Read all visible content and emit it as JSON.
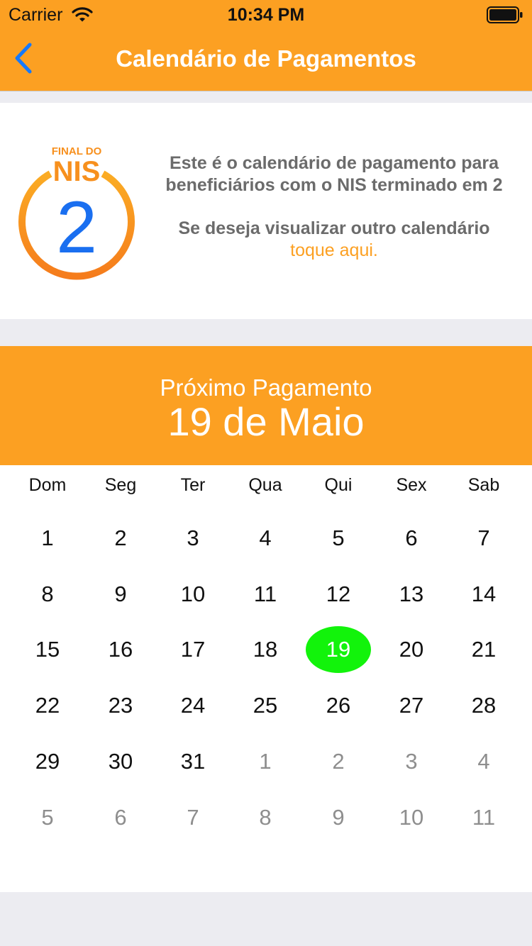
{
  "status_bar": {
    "carrier": "Carrier",
    "time": "10:34 PM"
  },
  "nav": {
    "title": "Calendário de Pagamentos",
    "back_icon": "chevron-left-icon"
  },
  "badge": {
    "top_text": "FINAL DO",
    "middle_text": "NIS",
    "digit": "2"
  },
  "info": {
    "line1": "Este é o calendário de pagamento para",
    "line2": "beneficiários com o NIS terminado em 2",
    "line3": "Se deseja visualizar outro calendário",
    "link": "toque aqui."
  },
  "next_payment": {
    "label": "Próximo Pagamento",
    "date": "19 de Maio"
  },
  "calendar": {
    "weekdays": [
      "Dom",
      "Seg",
      "Ter",
      "Qua",
      "Qui",
      "Sex",
      "Sab"
    ],
    "days": [
      "1",
      "2",
      "3",
      "4",
      "5",
      "6",
      "7",
      "8",
      "9",
      "10",
      "11",
      "12",
      "13",
      "14",
      "15",
      "16",
      "17",
      "18",
      "19",
      "20",
      "21",
      "22",
      "23",
      "24",
      "25",
      "26",
      "27",
      "28",
      "29",
      "30",
      "31",
      "1",
      "2",
      "3",
      "4",
      "5",
      "6",
      "7",
      "8",
      "9",
      "10",
      "11"
    ],
    "current_month_days": 31,
    "payment_day": "19"
  },
  "colors": {
    "accent": "#fca022",
    "payment_highlight": "#12f30b",
    "back_icon": "#1479ff",
    "badge_digit": "#1a6ff0"
  }
}
